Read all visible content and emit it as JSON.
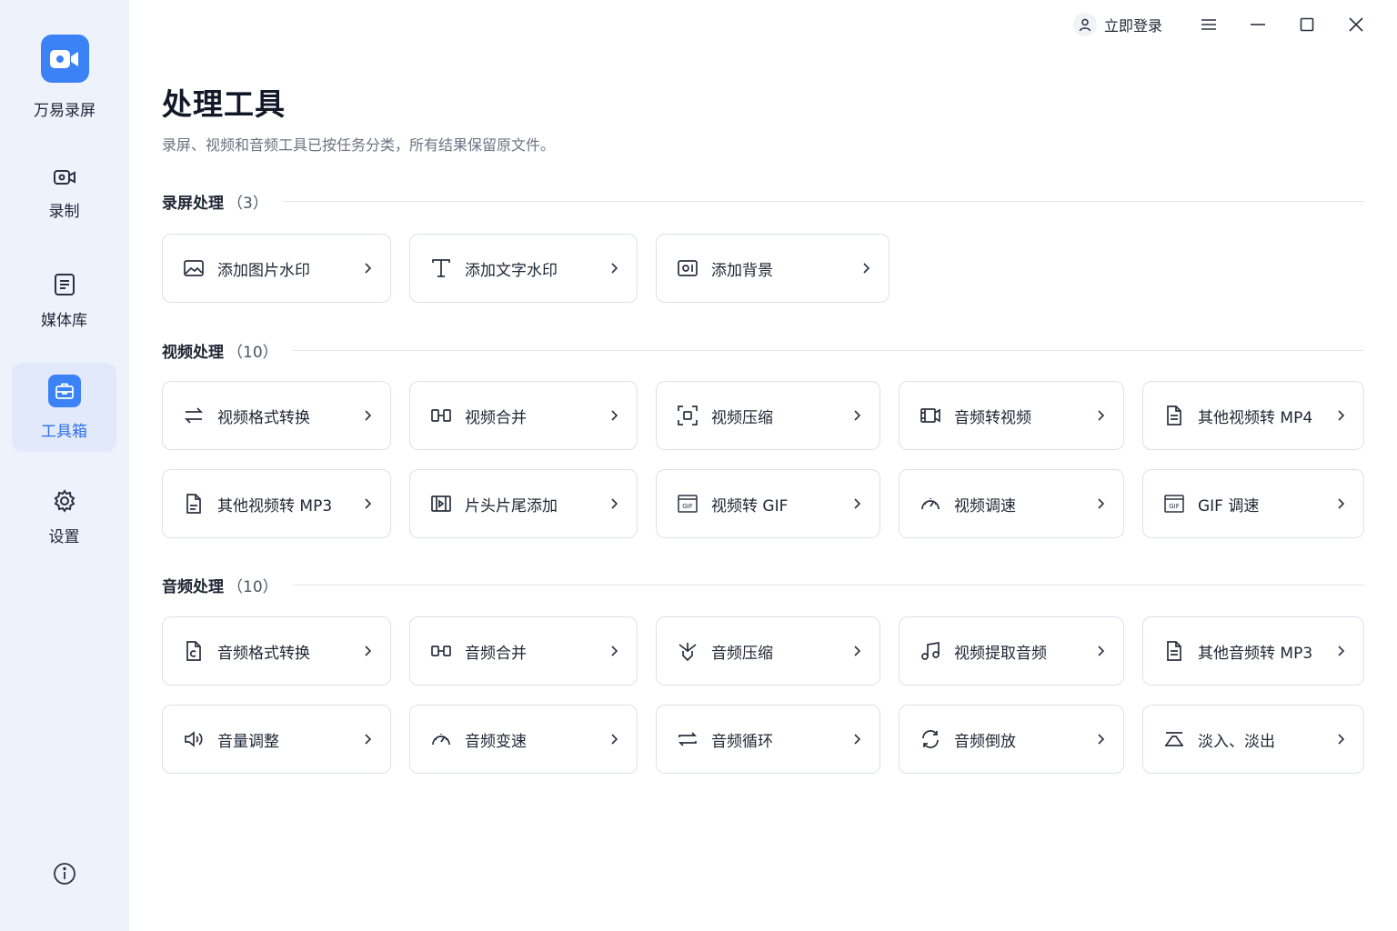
{
  "app": {
    "name": "万易录屏"
  },
  "sidebar": {
    "items": [
      {
        "label": "录制"
      },
      {
        "label": "媒体库"
      },
      {
        "label": "工具箱"
      },
      {
        "label": "设置"
      }
    ]
  },
  "titlebar": {
    "login_label": "立即登录"
  },
  "page": {
    "title": "处理工具",
    "subtitle": "录屏、视频和音频工具已按任务分类，所有结果保留原文件。"
  },
  "sections": [
    {
      "title": "录屏处理",
      "count": "（3）",
      "tools": [
        {
          "label": "添加图片水印",
          "icon": "image-icon"
        },
        {
          "label": "添加文字水印",
          "icon": "text-icon"
        },
        {
          "label": "添加背景",
          "icon": "background-icon"
        }
      ]
    },
    {
      "title": "视频处理",
      "count": "（10）",
      "tools": [
        {
          "label": "视频格式转换",
          "icon": "convert-icon"
        },
        {
          "label": "视频合并",
          "icon": "merge-icon"
        },
        {
          "label": "视频压缩",
          "icon": "compress-icon"
        },
        {
          "label": "音频转视频",
          "icon": "video-film-icon"
        },
        {
          "label": "其他视频转 MP4",
          "icon": "file-icon"
        },
        {
          "label": "其他视频转 MP3",
          "icon": "file-icon"
        },
        {
          "label": "片头片尾添加",
          "icon": "intro-outro-icon"
        },
        {
          "label": "视频转 GIF",
          "icon": "gif-icon"
        },
        {
          "label": "视频调速",
          "icon": "speed-icon"
        },
        {
          "label": "GIF 调速",
          "icon": "gif-icon"
        }
      ]
    },
    {
      "title": "音频处理",
      "count": "（10）",
      "tools": [
        {
          "label": "音频格式转换",
          "icon": "audio-file-icon"
        },
        {
          "label": "音频合并",
          "icon": "merge-icon"
        },
        {
          "label": "音频压缩",
          "icon": "audio-compress-icon"
        },
        {
          "label": "视频提取音频",
          "icon": "music-note-icon"
        },
        {
          "label": "其他音频转 MP3",
          "icon": "file-icon"
        },
        {
          "label": "音量调整",
          "icon": "volume-icon"
        },
        {
          "label": "音频变速",
          "icon": "speed-icon"
        },
        {
          "label": "音频循环",
          "icon": "loop-icon"
        },
        {
          "label": "音频倒放",
          "icon": "reverse-icon"
        },
        {
          "label": "淡入、淡出",
          "icon": "fade-icon"
        }
      ]
    }
  ],
  "colors": {
    "accent": "#3b82f6",
    "sidebar_bg": "#eef2fb",
    "active_bg": "#e2e9fa"
  }
}
